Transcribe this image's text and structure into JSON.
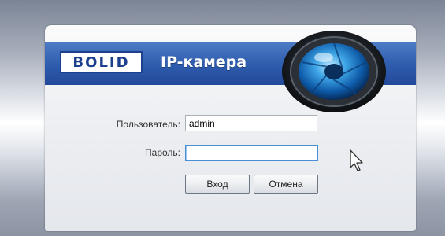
{
  "brand": {
    "logo_text": "BOLID",
    "product_title": "IP-камера"
  },
  "login_form": {
    "username_label": "Пользователь:",
    "username_value": "admin",
    "password_label": "Пароль:",
    "password_value": "",
    "login_button": "Вход",
    "cancel_button": "Отмена"
  },
  "colors": {
    "banner": "#2e5cae",
    "logo_blue": "#1c3f8e",
    "focus_border": "#4a8ed6"
  },
  "icons": [
    "camera-lens-icon",
    "mouse-cursor-icon"
  ]
}
